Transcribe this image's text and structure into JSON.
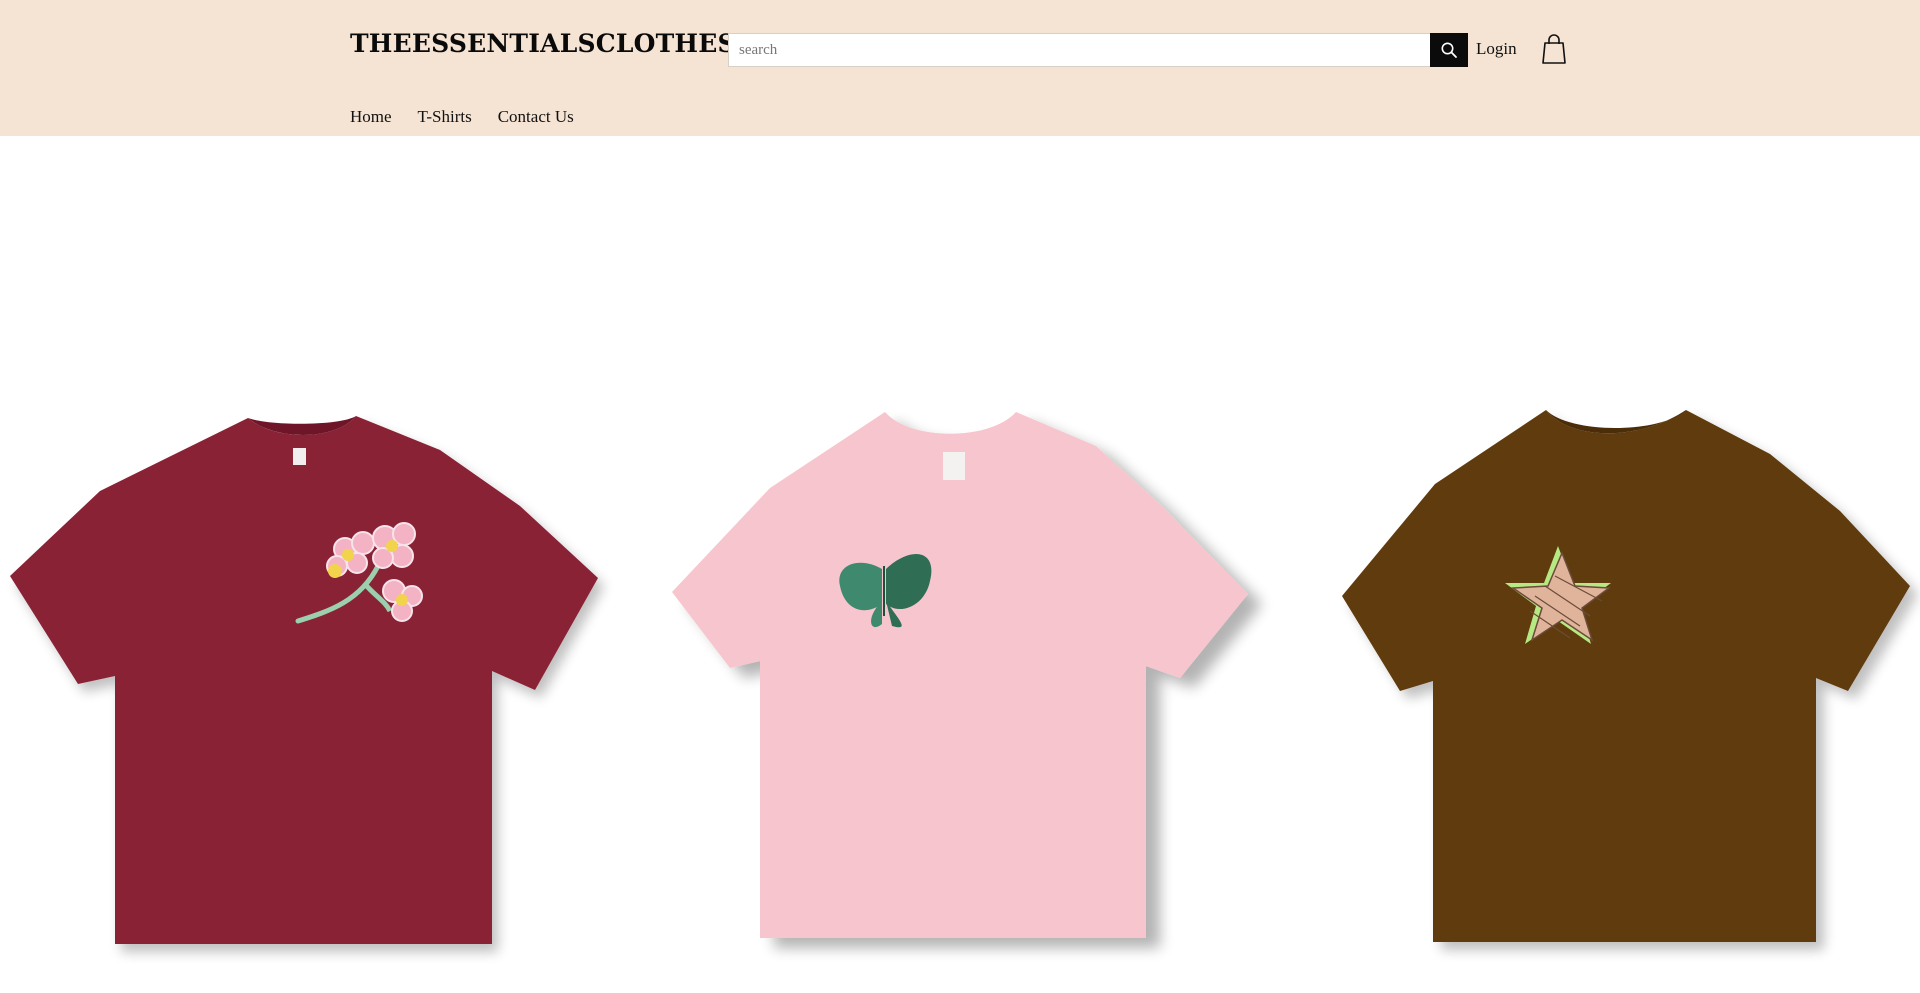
{
  "header": {
    "logo": "THEESSENTIALSCLOTHES",
    "search": {
      "placeholder": "search",
      "value": ""
    },
    "login_label": "Login",
    "nav": [
      {
        "label": "Home"
      },
      {
        "label": "T-Shirts"
      },
      {
        "label": "Contact Us"
      }
    ]
  },
  "products": [
    {
      "name": "burgundy-flower-tshirt",
      "shirt_color": "#8a2036",
      "print": "flower-branch"
    },
    {
      "name": "pink-butterfly-tshirt",
      "shirt_color": "#f7c5cd",
      "print": "butterfly"
    },
    {
      "name": "brown-star-tshirt",
      "shirt_color": "#5e3a0f",
      "print": "star"
    }
  ],
  "colors": {
    "header_bg": "#f5e4d3",
    "search_button": "#0b0b0b"
  },
  "icons": [
    "search-icon",
    "shopping-bag-icon"
  ]
}
